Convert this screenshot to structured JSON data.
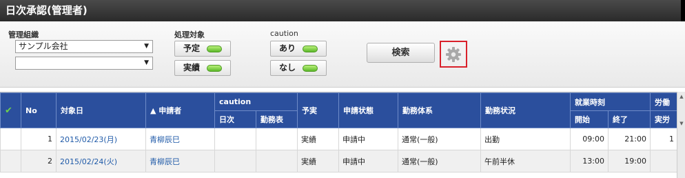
{
  "window": {
    "title": "日次承認(管理者)"
  },
  "filters": {
    "org_label": "管理組織",
    "org_select_value": "サンプル会社",
    "org_select_sub_value": "",
    "target_label": "処理対象",
    "target_buttons": [
      "予定",
      "実績"
    ],
    "caution_label": "caution",
    "caution_buttons": [
      "あり",
      "なし"
    ],
    "search_label": "検索",
    "settings_icon": "gear-icon"
  },
  "table": {
    "headers": {
      "check": "✔",
      "no": "No",
      "date": "対象日",
      "applicant": "▲ 申請者",
      "caution": "caution",
      "caution_daily": "日次",
      "caution_schedule": "勤務表",
      "plan_actual": "予実",
      "status": "申請状態",
      "work_type": "勤務体系",
      "work_state": "勤務状況",
      "work_time": "就業時刻",
      "start": "開始",
      "end": "終了",
      "labor": "労働",
      "labor_sub": "実労"
    },
    "rows": [
      {
        "no": "1",
        "date": "2015/02/23(月)",
        "applicant": "青柳辰巳",
        "plan_actual": "実績",
        "status": "申請中",
        "work_type": "通常(一般)",
        "work_state": "出勤",
        "start": "09:00",
        "end": "21:00",
        "labor": "1"
      },
      {
        "no": "2",
        "date": "2015/02/24(火)",
        "applicant": "青柳辰巳",
        "plan_actual": "実績",
        "status": "申請中",
        "work_type": "通常(一般)",
        "work_state": "午前半休",
        "start": "13:00",
        "end": "19:00",
        "labor": ""
      }
    ]
  },
  "colors": {
    "header_bg": "#2b4f9d",
    "link": "#1f5aa8",
    "toggle_on": "#5cb82a",
    "highlight_border": "#d9202a"
  }
}
